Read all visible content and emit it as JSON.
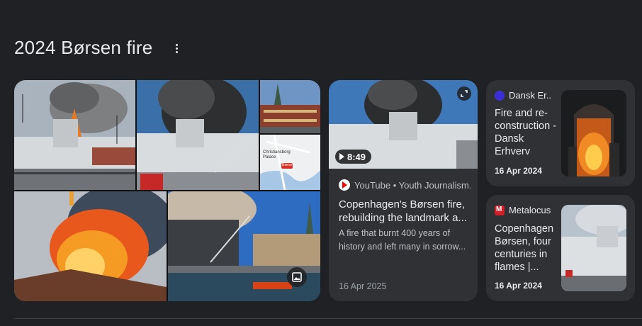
{
  "heading": {
    "title": "2024 Børsen fire"
  },
  "youtube_card": {
    "duration": "8:49",
    "source": "YouTube • Youth Journalism...",
    "title": "Copenhagen's Børsen fire, rebuilding the landmark a...",
    "description": "A fire that burnt 400 years of history and left many in sorrow...",
    "date": "16 Apr 2025"
  },
  "dansk_card": {
    "source": "Dansk Er...",
    "title": "Fire and re-construction - Dansk Erhverv",
    "date": "16 Apr 2024"
  },
  "metalocus_card": {
    "source": "Metalocus",
    "title": "Copenhagen Børsen, four centuries in flames |...",
    "date": "16 Apr 2024"
  },
  "map_tile": {
    "label_1": "Christiansborg Palace",
    "label_2": "Børsen"
  },
  "colors": {
    "background": "#202124",
    "card": "#303134",
    "text": "#e8eaed",
    "muted": "#bdc1c6",
    "youtube_red": "#ff0000",
    "dansk_blue": "#3a2fd6",
    "metalocus_red": "#d11f2b"
  },
  "icons": [
    "more-vert-icon",
    "expand-icon",
    "play-icon",
    "youtube-logo-icon",
    "dansk-erhverv-logo-icon",
    "metalocus-logo-icon",
    "image-gallery-icon"
  ]
}
